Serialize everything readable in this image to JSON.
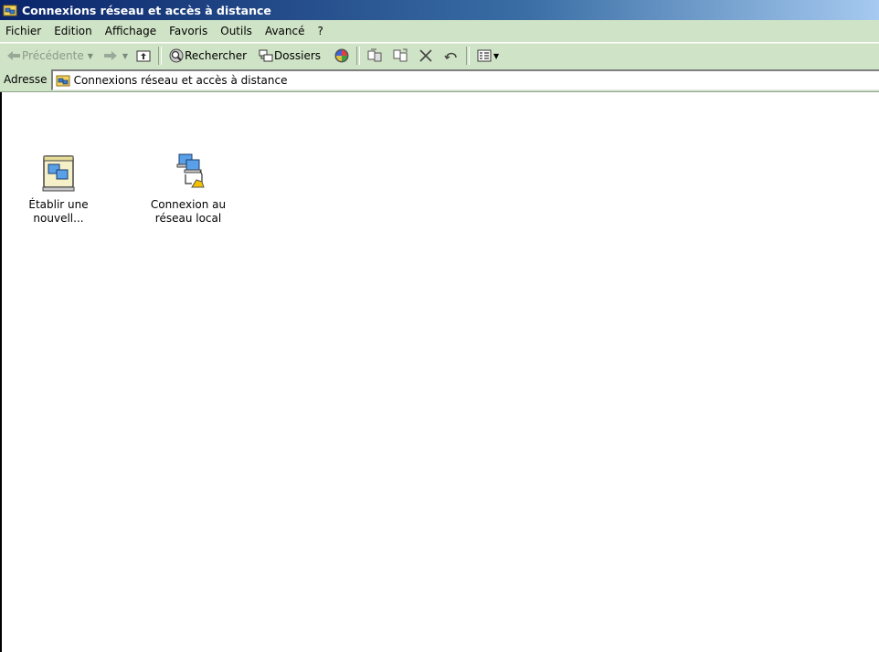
{
  "window": {
    "title": "Connexions réseau et accès à distance"
  },
  "menubar": {
    "items": [
      "Fichier",
      "Edition",
      "Affichage",
      "Favoris",
      "Outils",
      "Avancé",
      "?"
    ]
  },
  "toolbar": {
    "back_label": "Précédente",
    "search_label": "Rechercher",
    "folders_label": "Dossiers"
  },
  "address": {
    "label": "Adresse",
    "value": "Connexions réseau et accès à distance"
  },
  "items": [
    {
      "line1": "Établir une",
      "line2": "nouvell..."
    },
    {
      "line1": "Connexion au",
      "line2": "réseau local"
    }
  ],
  "colors": {
    "bar_background": "#cfe3c6",
    "title_gradient_start": "#0a246a",
    "title_gradient_end": "#a6caf0",
    "content_background": "#ffffff"
  },
  "icons": [
    "network-folder-icon",
    "back-arrow-icon",
    "forward-arrow-icon",
    "up-folder-icon",
    "search-icon",
    "folders-icon",
    "history-icon",
    "move-to-icon",
    "copy-to-icon",
    "delete-icon",
    "undo-icon",
    "views-icon",
    "new-connection-icon",
    "lan-connection-icon"
  ]
}
